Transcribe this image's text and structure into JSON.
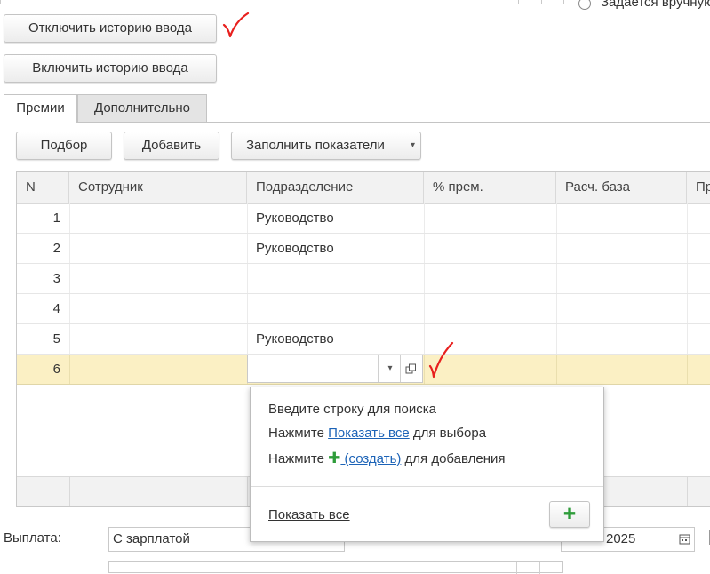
{
  "top": {
    "radio_label": "Задается вручную"
  },
  "buttons": {
    "disable_history": "Отключить историю ввода",
    "enable_history": "Включить историю ввода"
  },
  "tabs": [
    {
      "label": "Премии",
      "active": true
    },
    {
      "label": "Дополнительно",
      "active": false
    }
  ],
  "toolbar": {
    "pick": "Подбор",
    "add": "Добавить",
    "fill": "Заполнить показатели",
    "fill_arrow": "▾"
  },
  "table": {
    "columns": [
      "N",
      "Сотрудник",
      "Подразделение",
      "% прем.",
      "Расч. база",
      "Пр"
    ],
    "rows": [
      {
        "n": "1",
        "employee": "",
        "department": "Руководство",
        "percent": "",
        "base": ""
      },
      {
        "n": "2",
        "employee": "",
        "department": "Руководство",
        "percent": "",
        "base": ""
      },
      {
        "n": "3",
        "employee": "",
        "department": "",
        "percent": "",
        "base": ""
      },
      {
        "n": "4",
        "employee": "",
        "department": "",
        "percent": "",
        "base": ""
      },
      {
        "n": "5",
        "employee": "",
        "department": "Руководство",
        "percent": "",
        "base": ""
      },
      {
        "n": "6",
        "employee": "",
        "department": "",
        "percent": "",
        "base": "",
        "selected": true
      }
    ]
  },
  "popup": {
    "line1": "Введите строку для поиска",
    "line2_prefix": "Нажмите ",
    "line2_link": "Показать все",
    "line2_suffix": " для выбора",
    "line3_prefix": "Нажмите ",
    "line3_plus": "✚",
    "line3_link": " (создать)",
    "line3_suffix": " для добавления",
    "show_all": "Показать все",
    "add_button": "✚"
  },
  "bottom": {
    "payment_label": "Выплата:",
    "payment_value": "С зарплатой",
    "date_value": "2025"
  },
  "colors": {
    "selected_row": "#fbf0c4",
    "link": "#1c63b7",
    "plus": "#2e9c3a",
    "check_mark": "#e8201e"
  }
}
